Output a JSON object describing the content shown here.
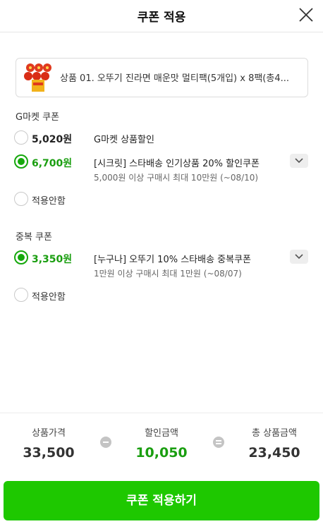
{
  "header": {
    "title": "쿠폰 적용",
    "close_icon": "close-icon"
  },
  "product": {
    "name": "상품 01. 오뚜기 진라면 매운맛 멀티팩(5개입) x 8팩(총4...",
    "thumb_icon": "product-thumbnail"
  },
  "gmarket_section": {
    "title": "G마켓 쿠폰",
    "options": [
      {
        "amount": "5,020원",
        "name": "G마켓 상품할인",
        "condition": "",
        "selected": false
      },
      {
        "amount": "6,700원",
        "name": "[시크릿] 스타배송 인기상품 20% 할인쿠폰",
        "condition": "5,000원 이상 구매시 최대 10만원 (~08/10)",
        "selected": true
      }
    ],
    "none_label": "적용안함"
  },
  "dup_section": {
    "title": "중복 쿠폰",
    "options": [
      {
        "amount": "3,350원",
        "name": "[누구나] 오뚜기 10% 스타배송 중복쿠폰",
        "condition": "1만원 이상 구매시 최대 1만원 (~08/07)",
        "selected": true
      }
    ],
    "none_label": "적용안함"
  },
  "summary": {
    "price_label": "상품가격",
    "price_value": "33,500",
    "discount_label": "할인금액",
    "discount_value": "10,050",
    "total_label": "총 상품금액",
    "total_value": "23,450"
  },
  "apply_button": "쿠폰 적용하기",
  "colors": {
    "accent": "#1ec800",
    "accent_text": "#1a9e10",
    "radio_checked": "#15a80c"
  }
}
